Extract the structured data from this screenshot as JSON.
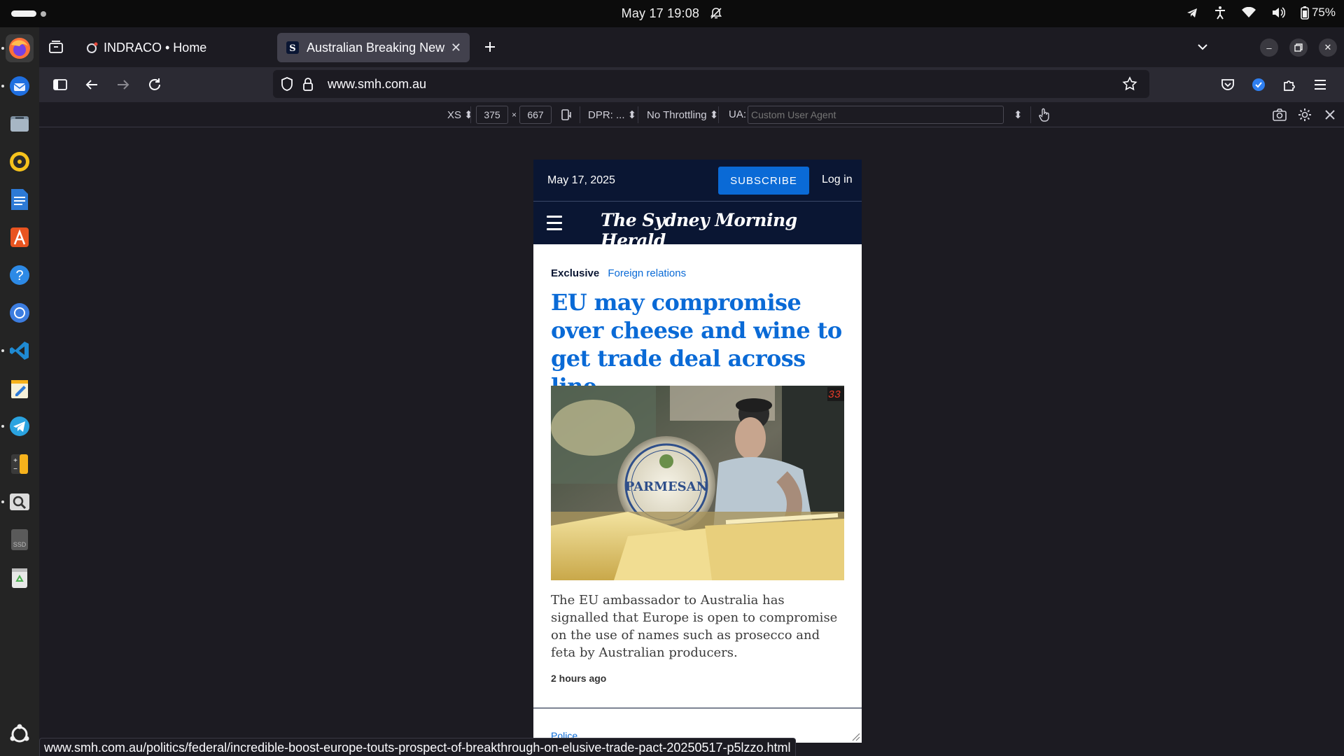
{
  "system": {
    "clock": "May 17  19:08",
    "battery": "75%"
  },
  "browser": {
    "tabs": [
      {
        "title": "INDRACO • Home",
        "active": false
      },
      {
        "title": "Australian Breaking News",
        "active": true
      }
    ],
    "url_domain": "www.smh.com.au",
    "hover_link": "www.smh.com.au/politics/federal/incredible-boost-europe-touts-prospect-of-breakthrough-on-elusive-trade-pact-20250517-p5lzzo.html"
  },
  "rdm": {
    "device": "XS",
    "width": "375",
    "times": "×",
    "height": "667",
    "dpr": "DPR: ...",
    "throttling": "No Throttling",
    "ua_label": "UA:",
    "ua_placeholder": "Custom User Agent"
  },
  "page": {
    "date": "May 17, 2025",
    "subscribe": "SUBSCRIBE",
    "login": "Log in",
    "masthead": "The Sydney Morning Herald",
    "kicker_exclusive": "Exclusive",
    "kicker_category": "Foreign relations",
    "headline": "EU may compromise over cheese and wine to get trade deal across line",
    "photo_label": "PARMESAN",
    "photo_counter": "33",
    "summary": "The EU ambassador to Australia has signalled that Europe is open to compromise on the use of names such as prosecco and feta by Australian producers.",
    "time": "2 hours ago",
    "next_kicker": "Police"
  },
  "colors": {
    "smh_navy": "#0a1633",
    "smh_blue": "#0a6ad6",
    "browser_bg": "#1c1b22",
    "toolbar_bg": "#2b2a33"
  }
}
